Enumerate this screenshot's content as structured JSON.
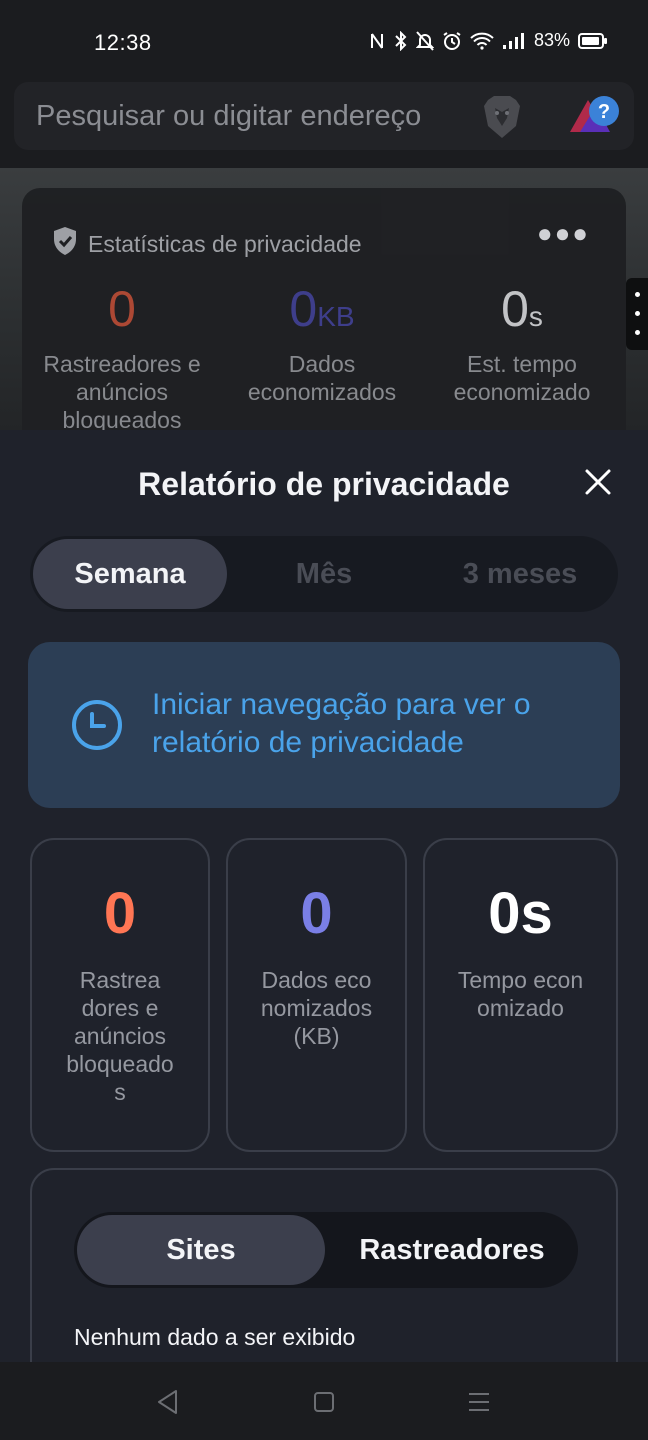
{
  "status_bar": {
    "time": "12:38",
    "battery": "83%",
    "icons": [
      "nfc-icon",
      "bluetooth-icon",
      "bell-off-icon",
      "alarm-icon",
      "wifi-icon",
      "signal-icon",
      "battery-icon"
    ]
  },
  "address_bar": {
    "placeholder": "Pesquisar ou digitar endereço",
    "icons": [
      "brave-shield-icon",
      "brave-rewards-icon"
    ]
  },
  "privacy_stats": {
    "header": "Estatísticas de privacidade",
    "more_icon": "more-icon",
    "items": [
      {
        "value": "0",
        "unit": "",
        "label": "Rastreadores e anúncios bloqueados",
        "color": "#b24a35"
      },
      {
        "value": "0",
        "unit": "KB",
        "label": "Dados economizados",
        "color": "#3f3f8f"
      },
      {
        "value": "0",
        "unit": "s",
        "label": "Est. tempo economizado",
        "color": "#c9cacd"
      }
    ]
  },
  "report_sheet": {
    "title": "Relatório de privacidade",
    "close_icon": "close-icon",
    "periods": [
      {
        "label": "Semana",
        "active": true
      },
      {
        "label": "Mês",
        "active": false
      },
      {
        "label": "3 meses",
        "active": false
      }
    ],
    "info": {
      "icon": "clock-icon",
      "text": "Iniciar navegação para ver o relatório de privacidade"
    },
    "metrics": [
      {
        "value": "0",
        "label": "Rastrea\ndores e\nanúncios\nbloqueado\ns",
        "color": "#ff7654"
      },
      {
        "value": "0",
        "label": "Dados eco\nnomizados\n(KB)",
        "color": "#7a7fe6"
      },
      {
        "value": "0s",
        "label": "Tempo econ\nomizado",
        "color": "#ffffff"
      }
    ],
    "list_tabs": [
      {
        "label": "Sites",
        "active": true
      },
      {
        "label": "Rastreadores",
        "active": false
      }
    ],
    "empty_text": "Nenhum dado a ser exibido"
  },
  "nav_bar": {
    "buttons": [
      "back-icon",
      "home-icon",
      "recents-icon"
    ]
  }
}
